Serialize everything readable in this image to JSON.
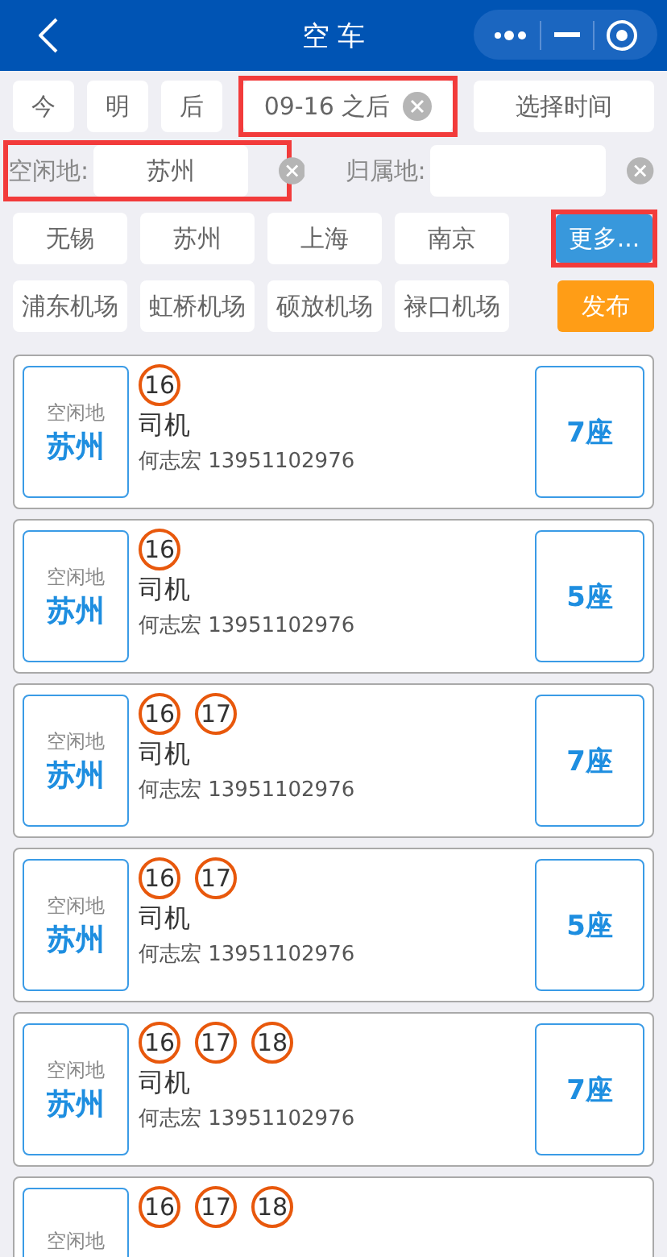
{
  "header": {
    "title": "空 车"
  },
  "date_chips": [
    {
      "label": "今",
      "highlighted": false,
      "clearable": false
    },
    {
      "label": "明",
      "highlighted": false,
      "clearable": false
    },
    {
      "label": "后",
      "highlighted": false,
      "clearable": false
    },
    {
      "label": "09-16 之后",
      "highlighted": true,
      "clearable": true
    }
  ],
  "time_button": "选择时间",
  "idle_place": {
    "label": "空闲地:",
    "value": "苏州",
    "highlighted": true
  },
  "home_place": {
    "label": "归属地:",
    "highlighted": false
  },
  "cities": [
    "无锡",
    "苏州",
    "上海",
    "南京"
  ],
  "more_button": {
    "label": "更多...",
    "highlighted": true
  },
  "airports": [
    "浦东机场",
    "虹桥机场",
    "硕放机场",
    "禄口机场"
  ],
  "publish_button": "发布",
  "cards": [
    {
      "place_label": "空闲地",
      "place": "苏州",
      "days": [
        "16"
      ],
      "role": "司机",
      "contact": "何志宏 13951102976",
      "seats": "7座"
    },
    {
      "place_label": "空闲地",
      "place": "苏州",
      "days": [
        "16"
      ],
      "role": "司机",
      "contact": "何志宏 13951102976",
      "seats": "5座"
    },
    {
      "place_label": "空闲地",
      "place": "苏州",
      "days": [
        "16",
        "17"
      ],
      "role": "司机",
      "contact": "何志宏 13951102976",
      "seats": "7座"
    },
    {
      "place_label": "空闲地",
      "place": "苏州",
      "days": [
        "16",
        "17"
      ],
      "role": "司机",
      "contact": "何志宏 13951102976",
      "seats": "5座"
    },
    {
      "place_label": "空闲地",
      "place": "苏州",
      "days": [
        "16",
        "17",
        "18"
      ],
      "role": "司机",
      "contact": "何志宏 13951102976",
      "seats": "7座"
    },
    {
      "place_label": "空闲地",
      "days": [
        "16",
        "17",
        "18"
      ]
    }
  ]
}
